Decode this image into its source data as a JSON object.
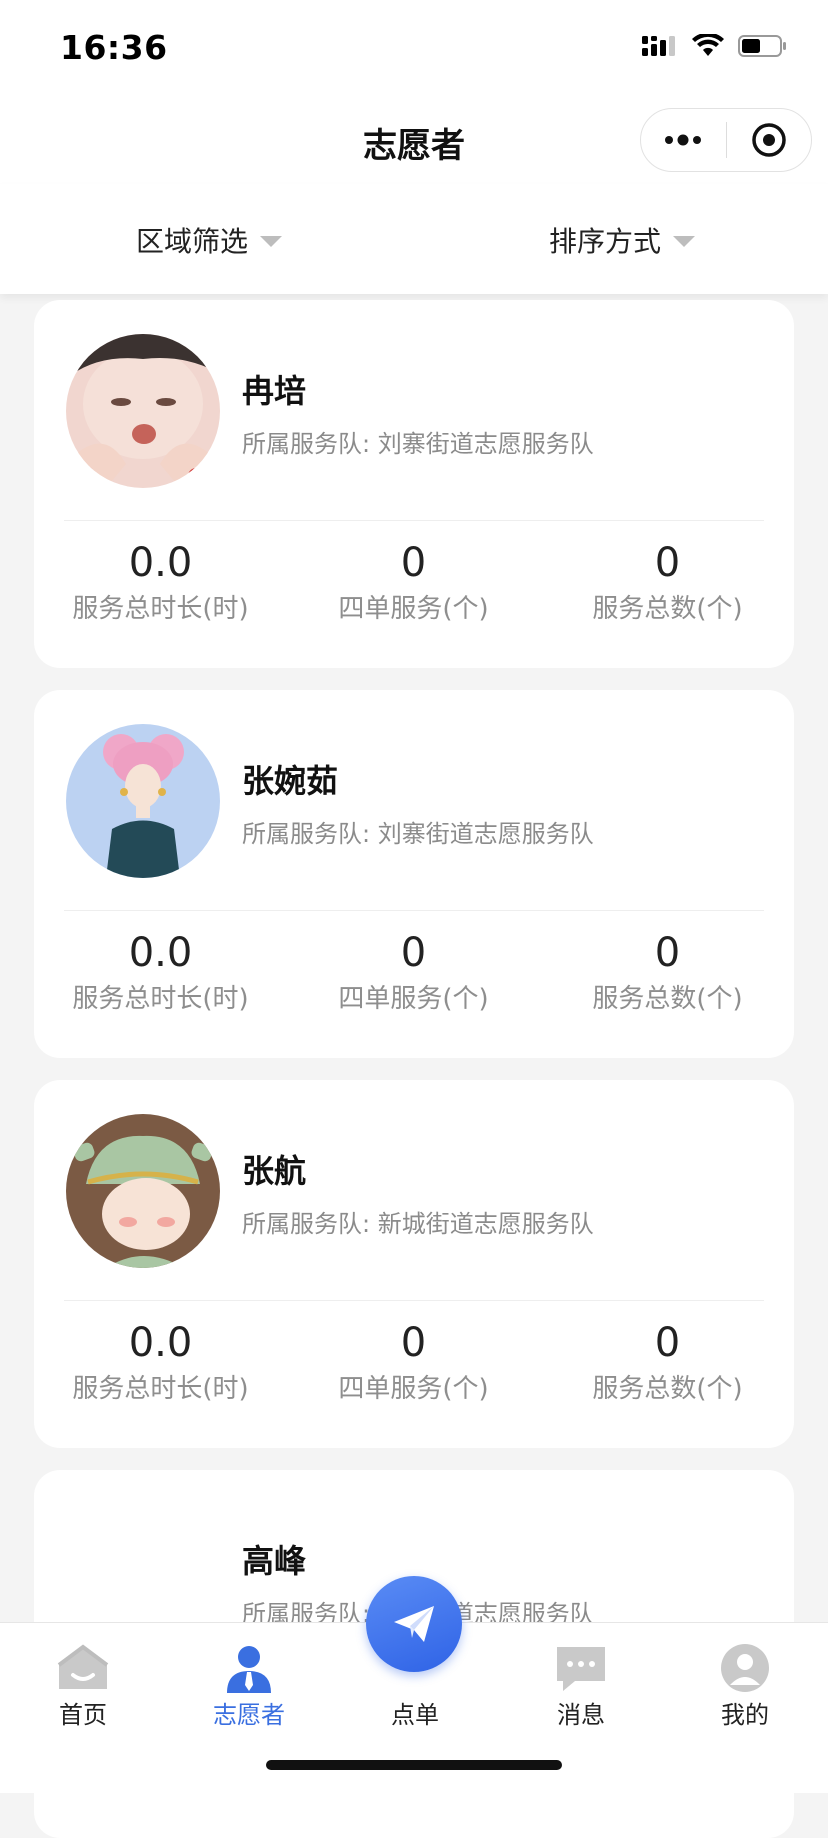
{
  "status_bar": {
    "time": "16:36"
  },
  "header": {
    "title": "志愿者"
  },
  "filters": {
    "region": "区域筛选",
    "sort": "排序方式"
  },
  "volunteers": [
    {
      "name": "冉培",
      "team": "所属服务队: 刘寨街道志愿服务队",
      "hours": "0.0",
      "four_orders": "0",
      "total": "0",
      "hours_label": "服务总时长(时)",
      "four_orders_label": "四单服务(个)",
      "total_label": "服务总数(个)"
    },
    {
      "name": "张婉茹",
      "team": "所属服务队: 刘寨街道志愿服务队",
      "hours": "0.0",
      "four_orders": "0",
      "total": "0",
      "hours_label": "服务总时长(时)",
      "four_orders_label": "四单服务(个)",
      "total_label": "服务总数(个)"
    },
    {
      "name": "张航",
      "team": "所属服务队: 新城街道志愿服务队",
      "hours": "0.0",
      "four_orders": "0",
      "total": "0",
      "hours_label": "服务总时长(时)",
      "four_orders_label": "四单服务(个)",
      "total_label": "服务总数(个)"
    },
    {
      "name": "高峰",
      "team": "所属服务队: 新城街道志愿服务队"
    }
  ],
  "tab_bar": {
    "items": [
      {
        "label": "首页",
        "icon": "home-icon"
      },
      {
        "label": "志愿者",
        "icon": "volunteer-icon",
        "active": true
      },
      {
        "label": "点单",
        "icon": "paper-plane-icon"
      },
      {
        "label": "消息",
        "icon": "message-icon"
      },
      {
        "label": "我的",
        "icon": "profile-icon"
      }
    ]
  },
  "colors": {
    "accent": "#3a6fe0",
    "fab_gradient_start": "#5a8cf5",
    "fab_gradient_end": "#2f63e6"
  }
}
